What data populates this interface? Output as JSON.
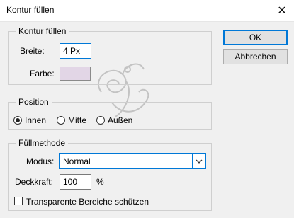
{
  "dialog": {
    "title": "Kontur füllen"
  },
  "stroke_group": {
    "legend": "Kontur füllen",
    "width_label": "Breite:",
    "width_value": "4 Px",
    "color_label": "Farbe:",
    "color_swatch": "#e2d6e6"
  },
  "position_group": {
    "legend": "Position",
    "options": [
      "Innen",
      "Mitte",
      "Außen"
    ],
    "selected": "Innen"
  },
  "blend_group": {
    "legend": "Füllmethode",
    "mode_label": "Modus:",
    "mode_value": "Normal",
    "opacity_label": "Deckkraft:",
    "opacity_value": "100",
    "opacity_unit": "%",
    "preserve_label": "Transparente Bereiche schützen",
    "preserve_checked": false
  },
  "buttons": {
    "ok": "OK",
    "cancel": "Abbrechen"
  },
  "colors": {
    "accent": "#0078d7",
    "window_bg": "#f0f0f0"
  }
}
